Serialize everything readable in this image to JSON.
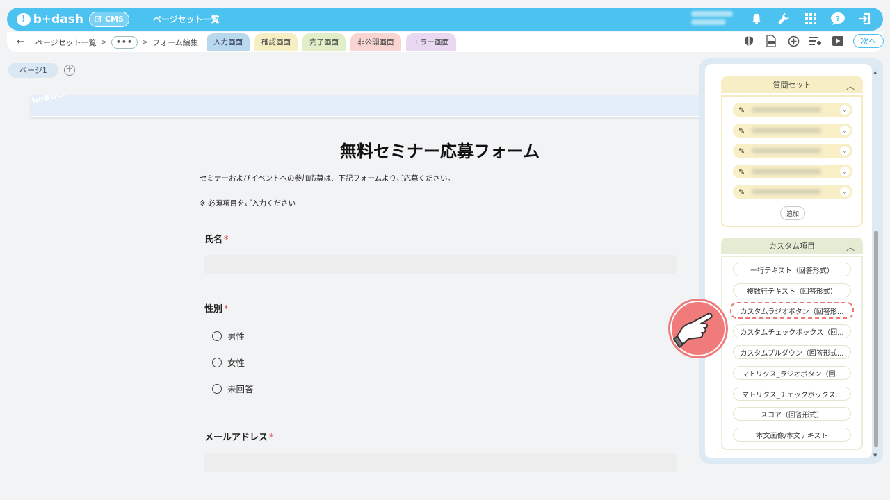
{
  "app": {
    "logo_text": "b+dash",
    "cms_label": "CMS",
    "title": "ページセット一覧"
  },
  "breadcrumb": {
    "back": "←",
    "item1": "ページセット一覧",
    "sep": ">",
    "more": "•••",
    "item2": "フォーム編集"
  },
  "tabs": [
    {
      "label": "入力画面"
    },
    {
      "label": "確認画面"
    },
    {
      "label": "完了画面"
    },
    {
      "label": "非公開画面"
    },
    {
      "label": "エラー画面"
    }
  ],
  "next_label": "次へ",
  "page_tab": "ページ1",
  "page_add": "+",
  "banner_word": "header",
  "form": {
    "title": "無料セミナー応募フォーム",
    "description": "セミナーおよびイベントへの参加応募は、下記フォームよりご応募ください。",
    "note": "※ 必須項目をご入力ください",
    "required_mark": "*",
    "name_label": "氏名",
    "gender_label": "性別",
    "gender_options": [
      "男性",
      "女性",
      "未回答"
    ],
    "email_label": "メールアドレス"
  },
  "panel": {
    "question_set_title": "質問セット",
    "add_label": "追加",
    "custom_title": "カスタム項目",
    "custom_items": [
      "一行テキスト（回答形式）",
      "複数行テキスト（回答形式）",
      "カスタムラジオボタン（回答形...",
      "カスタムチェックボックス（回...",
      "カスタムプルダウン（回答形式...",
      "マトリクス_ラジオボタン（回...",
      "マトリクス_チェックボックス...",
      "スコア（回答形式）",
      "本文画像/本文テキスト"
    ]
  },
  "colors": {
    "brand": "#4cc2f0",
    "highlight": "#e87a7a",
    "pointer": "#f07b7b"
  }
}
